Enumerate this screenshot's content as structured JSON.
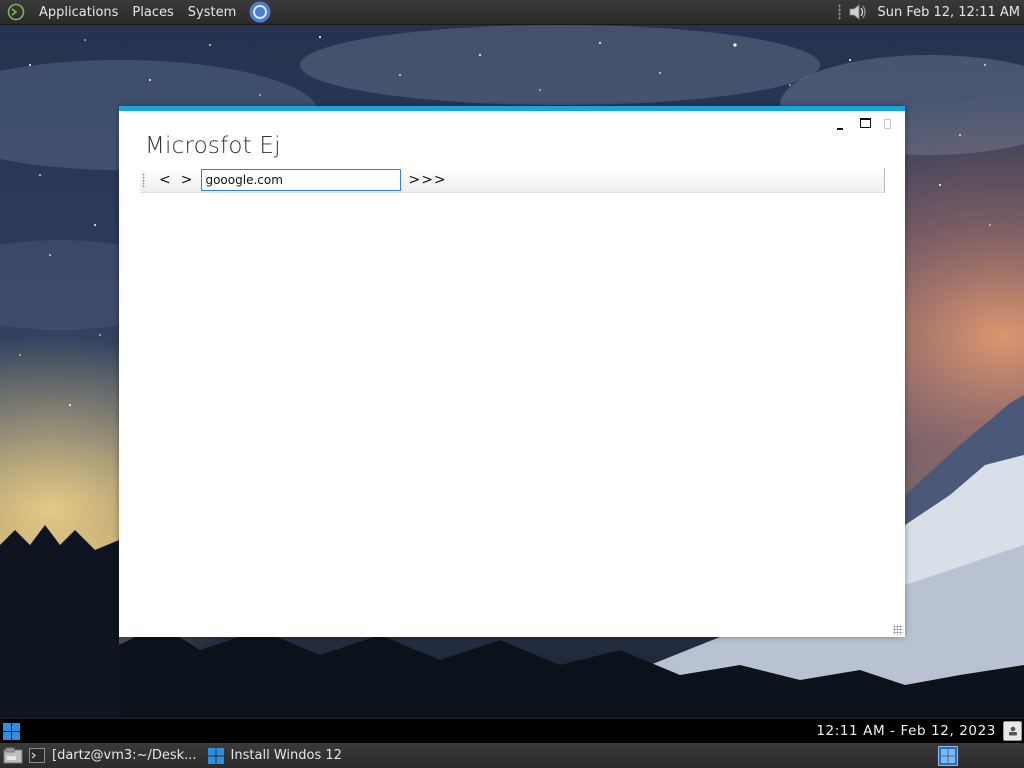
{
  "top_panel": {
    "menus": [
      "Applications",
      "Places",
      "System"
    ],
    "clock": "Sun Feb 12, 12:11 AM",
    "icons": [
      "distro-logo-icon",
      "chromium-icon",
      "volume-icon"
    ]
  },
  "window": {
    "title": "Microsfot Ej",
    "back_label": "<",
    "forward_label": ">",
    "url_value": "gooogle.com",
    "go_label": ">>>",
    "accent_color": "#1aa3e0"
  },
  "bottom_bar": {
    "clock": "12:11 AM - Feb 12, 2023",
    "icons": [
      "windows-start-icon",
      "notification-icon"
    ]
  },
  "taskbar": {
    "items": [
      {
        "label": "[dartz@vm3:~/Desk...",
        "icon": "terminal-icon"
      },
      {
        "label": "Install Windos 12",
        "icon": "windows-logo-icon"
      }
    ],
    "icons": [
      "show-desktop-icon",
      "workspace-switcher-icon"
    ]
  }
}
